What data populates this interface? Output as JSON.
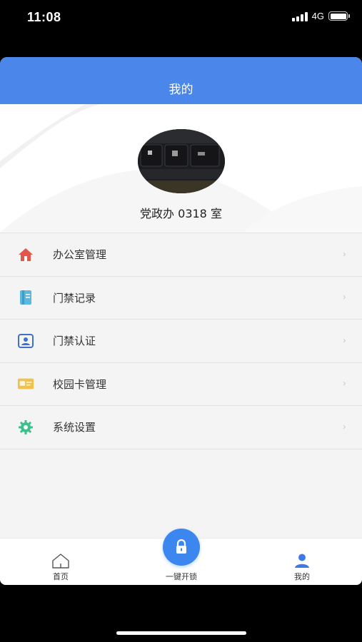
{
  "status_bar": {
    "time": "11:08",
    "network": "4G"
  },
  "header": {
    "title": "我的"
  },
  "profile": {
    "name": "党政办 0318 室"
  },
  "menu": {
    "items": [
      {
        "label": "办公室管理",
        "icon": "home-icon",
        "color": "#e2574c"
      },
      {
        "label": "门禁记录",
        "icon": "record-book-icon",
        "color": "#5bb8de"
      },
      {
        "label": "门禁认证",
        "icon": "id-card-icon",
        "color": "#3f6fd0"
      },
      {
        "label": "校园卡管理",
        "icon": "campus-card-icon",
        "color": "#f0c24b"
      },
      {
        "label": "系统设置",
        "icon": "gear-icon",
        "color": "#3fbf8a"
      }
    ],
    "chevron": "›"
  },
  "tabbar": {
    "home_label": "首页",
    "unlock_label": "一键开锁",
    "mine_label": "我的"
  },
  "colors": {
    "accent": "#4b86ea",
    "fab": "#3c86f0"
  }
}
